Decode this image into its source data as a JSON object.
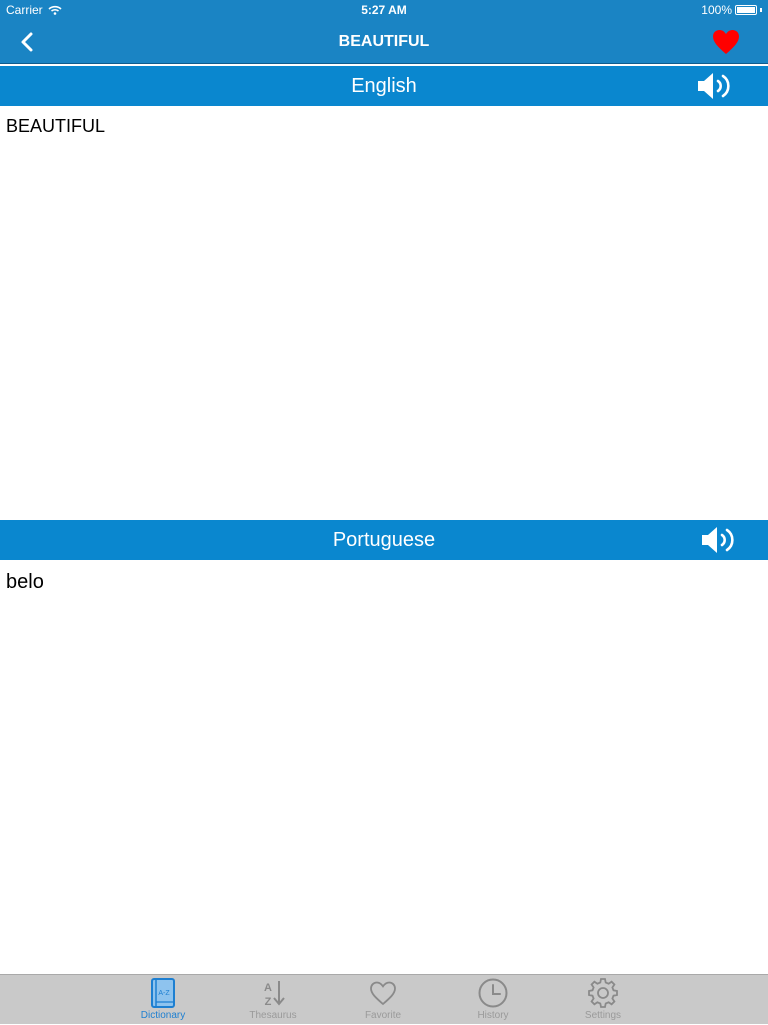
{
  "status_bar": {
    "carrier": "Carrier",
    "time": "5:27 AM",
    "battery": "100%"
  },
  "nav": {
    "title": "BEAUTIFUL",
    "back_icon": "chevron-left-icon",
    "favorite_icon": "heart-icon",
    "favorite_color": "#ff0000"
  },
  "source": {
    "language": "English",
    "text": "BEAUTIFUL",
    "icon": "speaker-icon"
  },
  "target": {
    "language": "Portuguese",
    "text": "belo",
    "icon": "speaker-icon"
  },
  "colors": {
    "bar": "#1a84c4",
    "language_bar": "#0a87cf",
    "tab_active": "#1d7fd1",
    "tab_inactive": "#9a9a9a"
  },
  "tabs": [
    {
      "label": "Dictionary",
      "icon": "dictionary-book-icon",
      "active": true
    },
    {
      "label": "Thesaurus",
      "icon": "az-sort-icon",
      "active": false
    },
    {
      "label": "Favorite",
      "icon": "heart-outline-icon",
      "active": false
    },
    {
      "label": "History",
      "icon": "clock-icon",
      "active": false
    },
    {
      "label": "Settings",
      "icon": "gear-icon",
      "active": false
    }
  ]
}
